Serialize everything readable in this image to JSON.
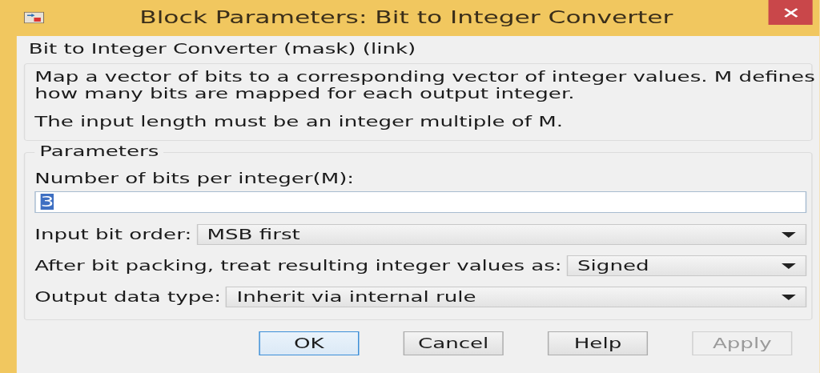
{
  "window": {
    "title": "Block Parameters: Bit to Integer Converter"
  },
  "header": "Bit to Integer Converter (mask) (link)",
  "description": [
    "Map a vector of bits to a corresponding vector of integer values. M defines how many bits are mapped for each output integer.",
    "The input length must be an integer multiple of M."
  ],
  "parameters": {
    "title": "Parameters",
    "fields": [
      {
        "kind": "text",
        "label": "Number of bits per integer(M):",
        "value": "3",
        "selected": true
      },
      {
        "kind": "dropdown",
        "label": "Input bit order:",
        "value": "MSB first"
      },
      {
        "kind": "dropdown",
        "label": "After bit packing, treat resulting integer values as:",
        "value": "Signed"
      },
      {
        "kind": "dropdown",
        "label": "Output data type:",
        "value": "Inherit via internal rule"
      }
    ]
  },
  "buttons": [
    {
      "label": "OK",
      "focused": true,
      "disabled": false
    },
    {
      "label": "Cancel",
      "focused": false,
      "disabled": false
    },
    {
      "label": "Help",
      "focused": false,
      "disabled": false
    },
    {
      "label": "Apply",
      "focused": false,
      "disabled": true
    }
  ]
}
